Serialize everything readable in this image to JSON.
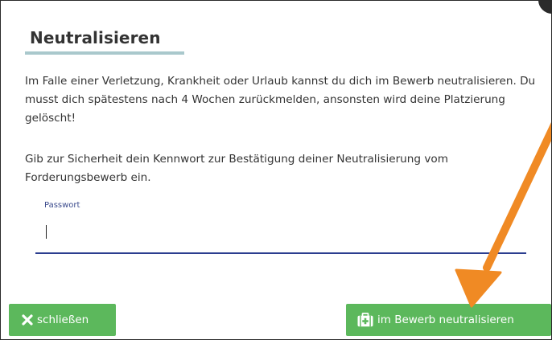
{
  "modal": {
    "title": "Neutralisieren",
    "paragraph_1": "Im Falle einer Verletzung, Krankheit oder Urlaub kannst du dich im Bewerb neutralisieren. Du musst dich spätestens nach 4 Wochen zurückmelden, ansonsten wird deine Platzierung gelöscht!",
    "paragraph_2": "Gib zur Sicherheit dein Kennwort zur Bestätigung deiner Neutralisierung vom Forderungsbewerb ein."
  },
  "password_field": {
    "label": "Passwort",
    "value": ""
  },
  "buttons": {
    "close_label": "schließen",
    "close_icon": "x-icon",
    "neutralize_label": "im Bewerb neutralisieren",
    "neutralize_icon": "medkit-icon"
  },
  "colors": {
    "button_green": "#5cb85c",
    "title_underline": "#a9c8cc",
    "input_underline": "#2b3d8f",
    "arrow_orange": "#f08a24"
  }
}
